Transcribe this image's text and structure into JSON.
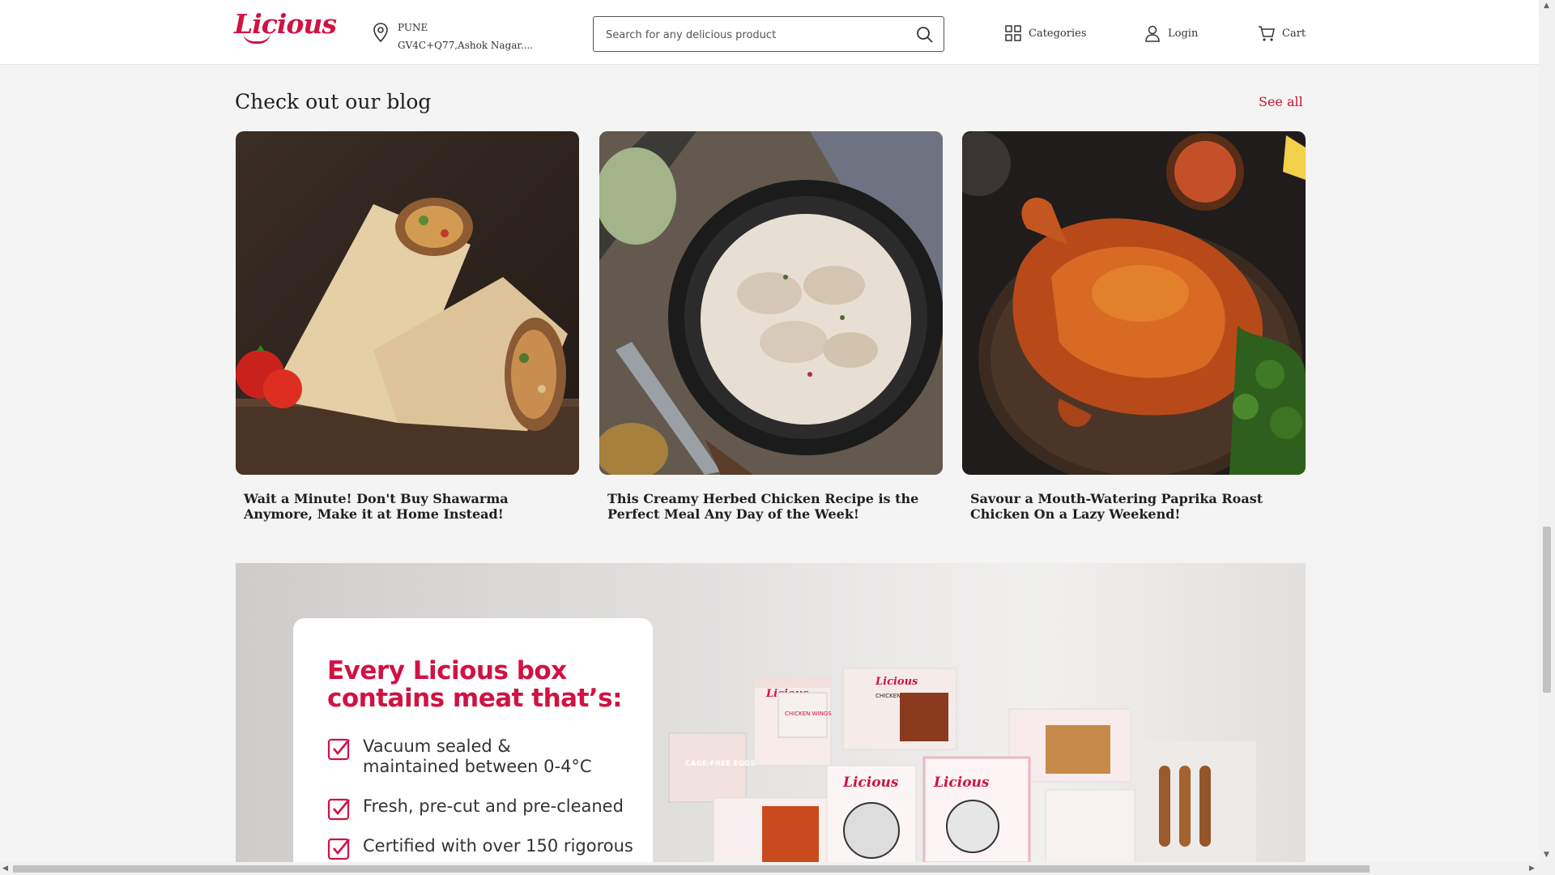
{
  "header": {
    "logo_text": "Licious",
    "location_city": "PUNE",
    "location_address": "GV4C+Q77,Ashok Nagar....",
    "search_placeholder": "Search for any delicious product",
    "nav": {
      "categories_label": "Categories",
      "login_label": "Login",
      "cart_label": "Cart"
    }
  },
  "blog": {
    "title": "Check out our blog",
    "see_all_label": "See all",
    "posts": [
      {
        "title": "Wait a Minute! Don't Buy Shawarma Anymore, Make it at Home Instead!",
        "image": "shawarma-wrap-photo"
      },
      {
        "title": "This Creamy Herbed Chicken Recipe is the Perfect Meal Any Day of the Week!",
        "image": "creamy-chicken-skillet-photo"
      },
      {
        "title": "Savour a Mouth-Watering Paprika Roast Chicken On a Lazy Weekend!",
        "image": "paprika-roast-chicken-photo"
      }
    ]
  },
  "banner": {
    "heading": "Every Licious box contains meat that’s:",
    "features": [
      "Vacuum sealed & maintained between 0-4°C",
      "Fresh, pre-cut and pre-cleaned",
      "Certified with over 150 rigorous"
    ],
    "box_labels": [
      "CAGE-FREE EGGS",
      "CHICKEN WINGS",
      "CHICKEN TANDOOR",
      "Licious"
    ]
  },
  "colors": {
    "brand": "#d11243",
    "link": "#c8102e",
    "page_bg": "#f4f4f4"
  }
}
